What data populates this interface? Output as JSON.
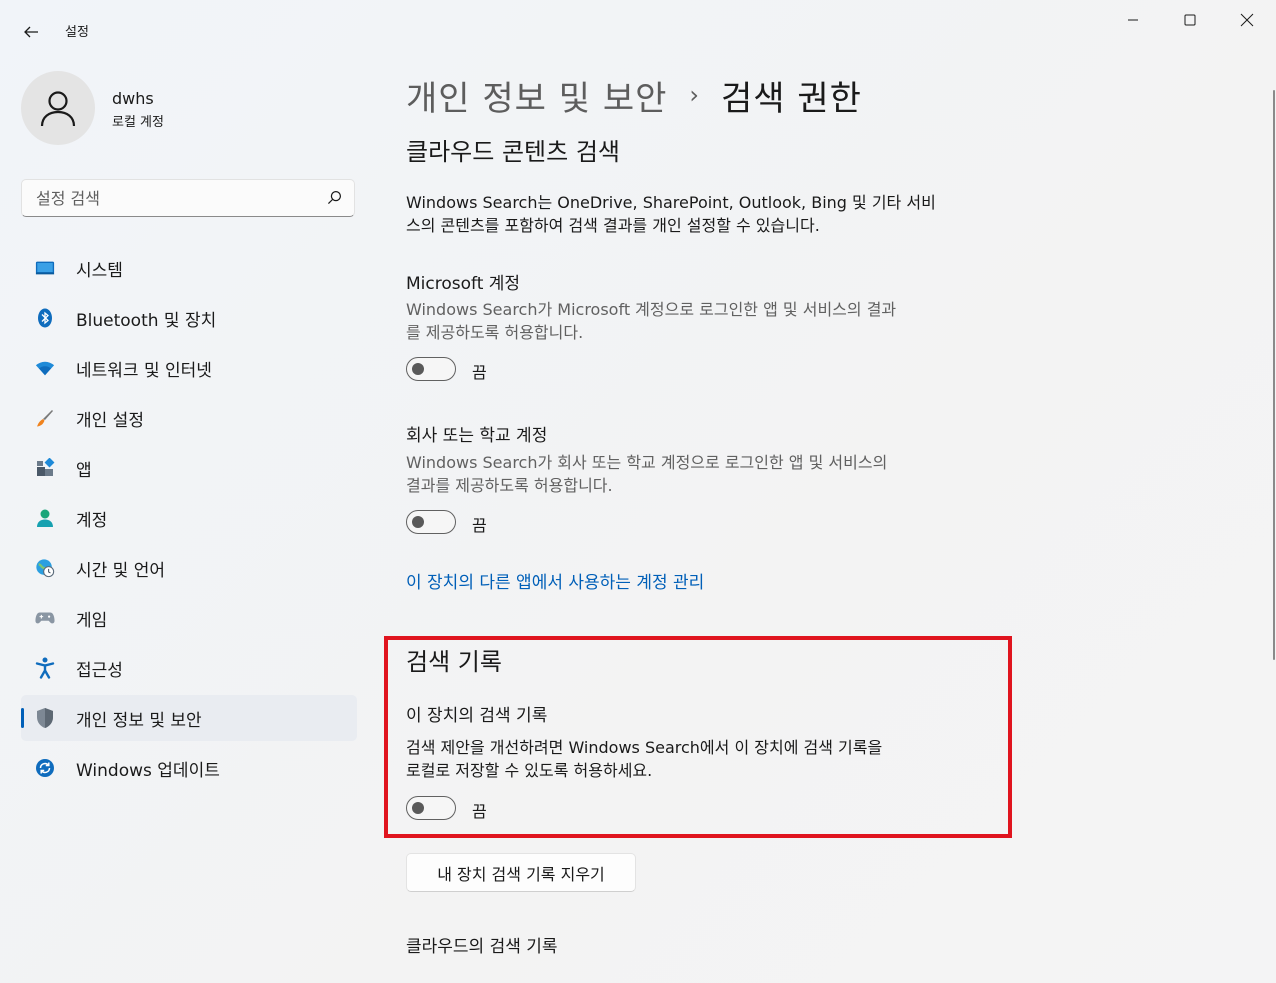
{
  "window": {
    "title": "설정",
    "controls": {
      "minimize": "minimize",
      "maximize": "maximize",
      "close": "close"
    }
  },
  "user": {
    "name": "dwhs",
    "account_type": "로컬 계정"
  },
  "search": {
    "placeholder": "설정 검색",
    "value": ""
  },
  "sidebar": {
    "items": [
      {
        "label": "시스템",
        "icon": "system-icon"
      },
      {
        "label": "Bluetooth 및 장치",
        "icon": "bluetooth-icon"
      },
      {
        "label": "네트워크 및 인터넷",
        "icon": "wifi-icon"
      },
      {
        "label": "개인 설정",
        "icon": "brush-icon"
      },
      {
        "label": "앱",
        "icon": "apps-icon"
      },
      {
        "label": "계정",
        "icon": "account-icon"
      },
      {
        "label": "시간 및 언어",
        "icon": "globe-clock-icon"
      },
      {
        "label": "게임",
        "icon": "gamepad-icon"
      },
      {
        "label": "접근성",
        "icon": "accessibility-icon"
      },
      {
        "label": "개인 정보 및 보안",
        "icon": "shield-icon",
        "selected": true
      },
      {
        "label": "Windows 업데이트",
        "icon": "update-icon"
      }
    ]
  },
  "breadcrumb": {
    "parent": "개인 정보 및 보안",
    "separator": "›",
    "current": "검색 권한"
  },
  "cloud_search": {
    "title": "클라우드 콘텐츠 검색",
    "description": "Windows Search는 OneDrive, SharePoint, Outlook, Bing 및 기타 서비스의 콘텐츠를 포함하여 검색 결과를 개인 설정할 수 수 있습니다.",
    "description_line1": "Windows Search는 OneDrive, SharePoint, Outlook, Bing 및 기타 서비",
    "description_line2": "스의 콘텐츠를 포함하여 검색 결과를 개인 설정할 수 있습니다.",
    "microsoft_account": {
      "title": "Microsoft 계정",
      "desc_line1": "Windows Search가 Microsoft 계정으로 로그인한 앱 및 서비스의 결과",
      "desc_line2": "를 제공하도록 허용합니다.",
      "state": "끔",
      "on": false
    },
    "work_school": {
      "title": "회사 또는 학교 계정",
      "desc_line1": "Windows Search가 회사 또는 학교 계정으로 로그인한 앱 및 서비스의",
      "desc_line2": "결과를 제공하도록 허용합니다.",
      "state": "끔",
      "on": false
    },
    "manage_link": "이 장치의 다른 앱에서 사용하는 계정 관리"
  },
  "search_history": {
    "title": "검색 기록",
    "device_history": {
      "title": "이 장치의 검색 기록",
      "desc_line1": "검색 제안을 개선하려면 Windows Search에서 이 장치에 검색 기록을",
      "desc_line2": "로컬로 저장할 수 있도록 허용하세요.",
      "state": "끔",
      "on": false
    },
    "clear_button": "내 장치 검색 기록 지우기",
    "cloud_history_title": "클라우드의 검색 기록"
  },
  "colors": {
    "accent": "#005fb8",
    "highlight": "#e0141e"
  }
}
